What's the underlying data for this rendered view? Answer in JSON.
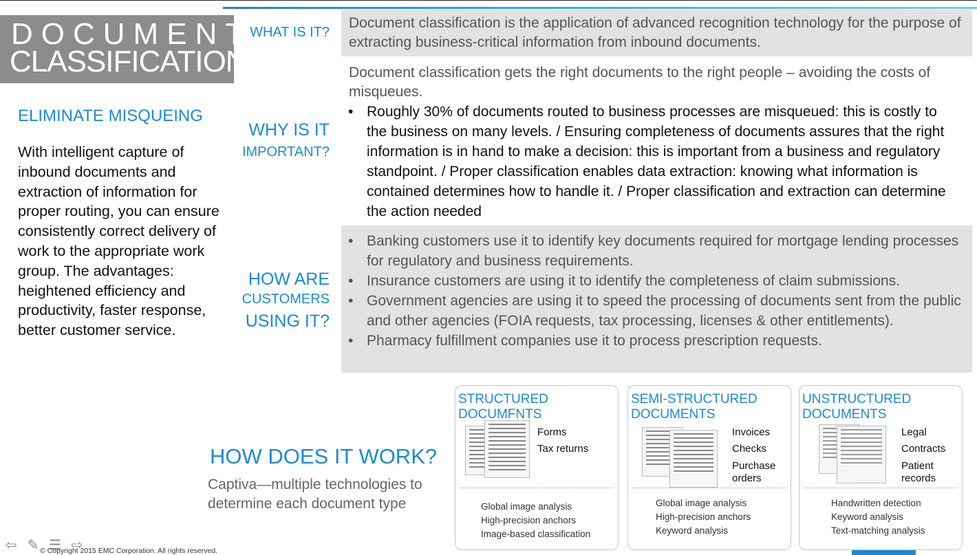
{
  "title": {
    "line1": "DOCUMENT",
    "line2": "CLASSIFICATION"
  },
  "side": {
    "heading": "ELIMINATE MISQUEING",
    "body": "With intelligent capture of inbound documents and extraction of information for proper routing, you can ensure consistently correct delivery of work to the appropriate work group. The advantages: heightened efficiency and productivity, faster response, better customer service."
  },
  "questions": {
    "what": "WHAT IS IT?",
    "why_big": "WHY IS IT",
    "why_small": "IMPORTANT?",
    "how_big": "HOW ARE",
    "how_small": "CUSTOMERS",
    "how_big2": "USING IT?"
  },
  "what": {
    "text": "Document classification is the application of advanced recognition technology for the purpose of extracting business-critical information from inbound documents."
  },
  "why": {
    "intro": "Document classification gets the right documents to the right people – avoiding the costs of misqueues.",
    "bullet_char": "•",
    "bullet": "Roughly 30% of documents routed to business processes are misqueued: this is costly to the business on many levels.  / Ensuring completeness of documents assures that the right information is in hand to make a decision: this is important from a business and regulatory standpoint.  / Proper classification enables data extraction: knowing what information is contained determines how to handle it.  / Proper classification and extraction can determine the action needed"
  },
  "how": {
    "bullet_char": "•",
    "items": [
      "Banking customers use it to identify key documents required for mortgage lending processes for regulatory and business requirements.",
      "Insurance customers are using it to identify the completeness of claim submissions.",
      "Government agencies are using it to speed the processing of documents sent from the public and other agencies (FOIA requests, tax processing, licenses & other entitlements).",
      "Pharmacy fulfillment companies use it to process prescription requests."
    ]
  },
  "work": {
    "title": "HOW DOES IT WORK?",
    "subtitle": "Captiva—multiple technologies to determine each document type"
  },
  "cards": [
    {
      "title": "STRUCTURED DOCUMFNTS",
      "types": [
        "Forms",
        "Tax returns"
      ],
      "methods": [
        "Global image analysis",
        "High-precision anchors",
        "Image-based classification"
      ]
    },
    {
      "title": "SEMI-STRUCTURED DOCUMENTS",
      "types": [
        "Invoices",
        "Checks",
        "Purchase orders"
      ],
      "methods": [
        "Global image analysis",
        "High-precision anchors",
        "Keyword analysis"
      ]
    },
    {
      "title": "UNSTRUCTURED DOCUMENTS",
      "types": [
        "Legal",
        "Contracts",
        "Patient records"
      ],
      "methods": [
        "Handwritten detection",
        "Keyword analysis",
        "Text-matching analysis"
      ]
    }
  ],
  "footer": {
    "copyright": "© Copyright 2015 EMC Corporation. All rights reserved.",
    "icons": [
      "arrow-left-icon",
      "pencil-icon",
      "menu-icon",
      "arrow-right-icon"
    ]
  },
  "colors": {
    "accent": "#1b8ad3",
    "title_bg": "#8c8c8c",
    "panel_bg": "#e2e2e2"
  }
}
